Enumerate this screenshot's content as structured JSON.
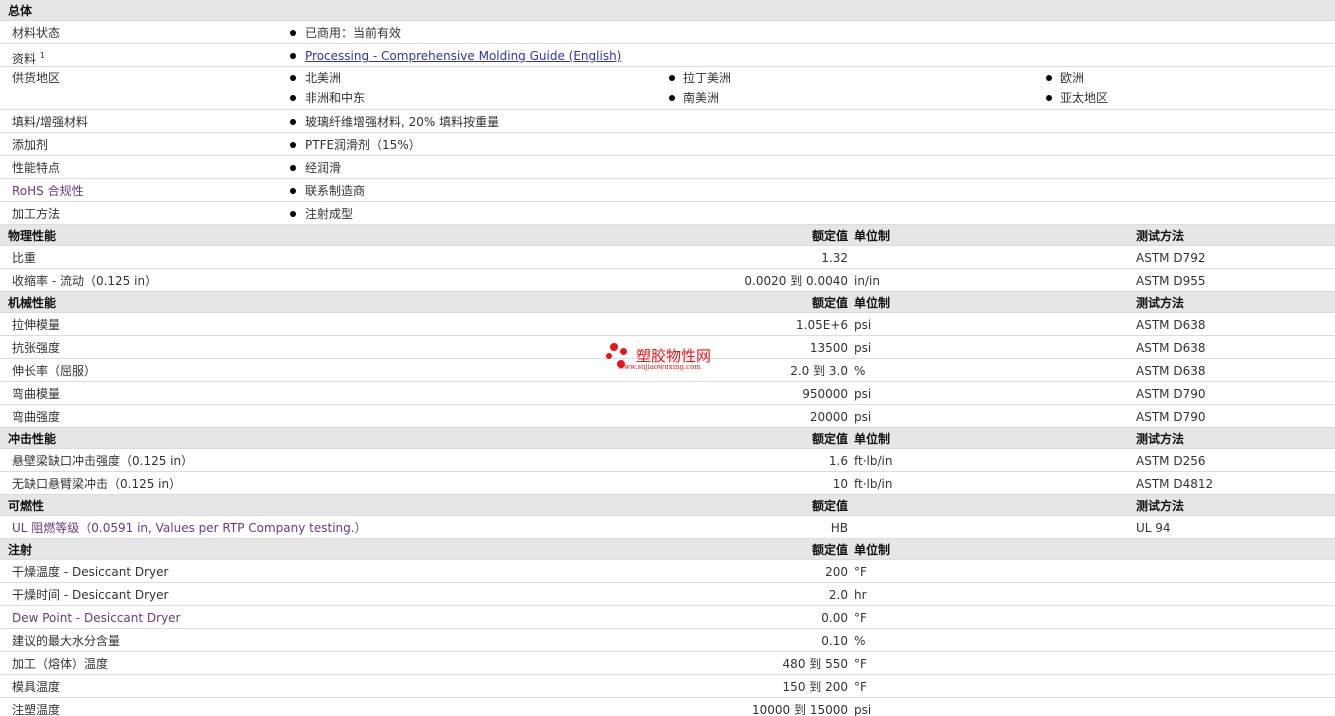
{
  "general": {
    "title": "总体",
    "status_label": "材料状态",
    "status_value": "已商用：当前有效",
    "docs_label": "资料",
    "docs_sup": "1",
    "docs_link": "Processing - Comprehensive Molding Guide (English)",
    "region_label": "供货地区",
    "regions": [
      "北美洲",
      "拉丁美洲",
      "欧洲",
      "非洲和中东",
      "南美洲",
      "亚太地区"
    ],
    "filler_label": "填料/增强材料",
    "filler_value": "玻璃纤维增强材料, 20% 填料按重量",
    "additive_label": "添加剂",
    "additive_value": "PTFE润滑剂（15%）",
    "feature_label": "性能特点",
    "feature_value": "经润滑",
    "rohs_label": "RoHS 合规性",
    "rohs_value": "联系制造商",
    "process_label": "加工方法",
    "process_value": "注射成型"
  },
  "headers": {
    "nominal": "额定值",
    "unit": "单位制",
    "test": "测试方法"
  },
  "sections": [
    {
      "title": "物理性能",
      "show_unit": true,
      "rows": [
        {
          "label": "比重",
          "value": "1.32",
          "unit": "",
          "test": "ASTM D792"
        },
        {
          "label": "收缩率  - 流动（0.125 in）",
          "value": "0.0020 到  0.0040",
          "unit": "in/in",
          "test": "ASTM D955"
        }
      ]
    },
    {
      "title": "机械性能",
      "show_unit": true,
      "rows": [
        {
          "label": "拉伸模量",
          "value": "1.05E+6",
          "unit": "psi",
          "test": "ASTM D638"
        },
        {
          "label": "抗张强度",
          "value": "13500",
          "unit": "psi",
          "test": "ASTM D638"
        },
        {
          "label": "伸长率（屈服）",
          "value": "2.0 到  3.0",
          "unit": "%",
          "test": "ASTM D638"
        },
        {
          "label": "弯曲模量",
          "value": "950000",
          "unit": "psi",
          "test": "ASTM D790"
        },
        {
          "label": "弯曲强度",
          "value": "20000",
          "unit": "psi",
          "test": "ASTM D790"
        }
      ]
    },
    {
      "title": "冲击性能",
      "show_unit": true,
      "rows": [
        {
          "label": "悬壁梁缺口冲击强度（0.125 in）",
          "value": "1.6",
          "unit": "ft·lb/in",
          "test": "ASTM D256"
        },
        {
          "label": "无缺口悬臂梁冲击（0.125 in）",
          "value": "10",
          "unit": "ft·lb/in",
          "test": "ASTM D4812"
        }
      ]
    },
    {
      "title": "可燃性",
      "show_unit": false,
      "rows": [
        {
          "label": "UL 阻燃等级（0.0591 in, Values per RTP Company testing.）",
          "value": "HB",
          "unit": "",
          "test": "UL 94",
          "purple": true
        }
      ]
    },
    {
      "title": "注射",
      "show_unit": true,
      "no_test": true,
      "rows": [
        {
          "label": "干燥温度  - Desiccant Dryer",
          "value": "200",
          "unit": "°F",
          "test": ""
        },
        {
          "label": "干燥时间  - Desiccant Dryer",
          "value": "2.0",
          "unit": "hr",
          "test": ""
        },
        {
          "label": "Dew Point - Desiccant Dryer",
          "value": "0.00",
          "unit": "°F",
          "test": "",
          "purple": true
        },
        {
          "label": "建议的最大水分含量",
          "value": "0.10",
          "unit": "%",
          "test": ""
        },
        {
          "label": "加工（熔体）温度",
          "value": "480 到  550",
          "unit": "°F",
          "test": ""
        },
        {
          "label": "模具温度",
          "value": "150 到  200",
          "unit": "°F",
          "test": ""
        },
        {
          "label": "注塑温度",
          "value": "10000 到  15000",
          "unit": "psi",
          "test": ""
        }
      ]
    }
  ],
  "watermark": {
    "title": "塑胶物性网",
    "url": "www.sujiaowuxing.com",
    "color": "#e8141b"
  }
}
